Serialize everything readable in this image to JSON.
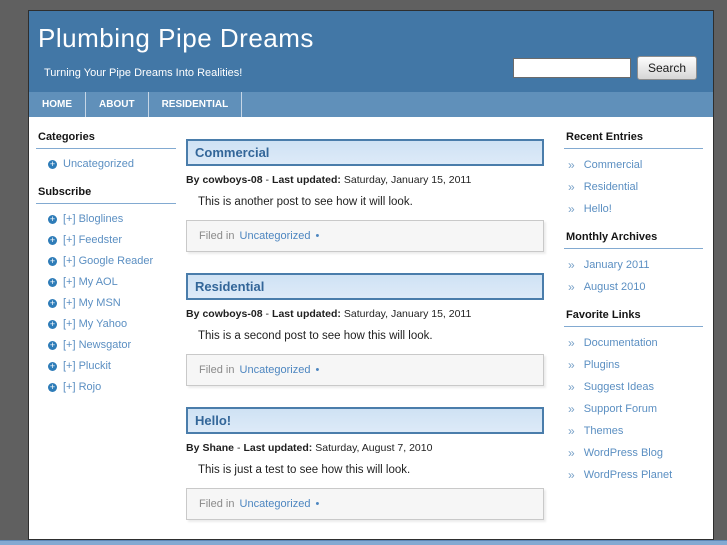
{
  "header": {
    "title": "Plumbing Pipe Dreams",
    "tagline": "Turning Your Pipe Dreams Into Realities!"
  },
  "search": {
    "button_label": "Search",
    "value": ""
  },
  "nav": {
    "items": [
      {
        "label": "HOME"
      },
      {
        "label": "ABOUT"
      },
      {
        "label": "RESIDENTIAL"
      }
    ]
  },
  "left_sidebar": {
    "sections": [
      {
        "title": "Categories",
        "items": [
          {
            "label": "Uncategorized"
          }
        ]
      },
      {
        "title": "Subscribe",
        "items": [
          {
            "label": "[+] Bloglines"
          },
          {
            "label": "[+] Feedster"
          },
          {
            "label": "[+] Google Reader"
          },
          {
            "label": "[+] My AOL"
          },
          {
            "label": "[+] My MSN"
          },
          {
            "label": "[+] My Yahoo"
          },
          {
            "label": "[+] Newsgator"
          },
          {
            "label": "[+] Pluckit"
          },
          {
            "label": "[+] Rojo"
          }
        ]
      }
    ]
  },
  "posts": [
    {
      "title": "Commercial",
      "by_label": "By",
      "author": "cowboys-08",
      "dash": "-",
      "updated_label": "Last updated:",
      "date": "Saturday, January 15, 2011",
      "body": "This is another post to see how it will look.",
      "filed_label": "Filed in",
      "category": "Uncategorized",
      "bullet": "•"
    },
    {
      "title": "Residential",
      "by_label": "By",
      "author": "cowboys-08",
      "dash": "-",
      "updated_label": "Last updated:",
      "date": "Saturday, January 15, 2011",
      "body": "This is a second post to see how this will look.",
      "filed_label": "Filed in",
      "category": "Uncategorized",
      "bullet": "•"
    },
    {
      "title": "Hello!",
      "by_label": "By",
      "author": "Shane",
      "dash": "-",
      "updated_label": "Last updated:",
      "date": "Saturday, August 7, 2010",
      "body": "This is just a test to see how this will look.",
      "filed_label": "Filed in",
      "category": "Uncategorized",
      "bullet": "•"
    }
  ],
  "right_sidebar": {
    "sections": [
      {
        "title": "Recent Entries",
        "items": [
          {
            "label": "Commercial"
          },
          {
            "label": "Residential"
          },
          {
            "label": "Hello!"
          }
        ]
      },
      {
        "title": "Monthly Archives",
        "items": [
          {
            "label": "January 2011"
          },
          {
            "label": "August 2010"
          }
        ]
      },
      {
        "title": "Favorite Links",
        "items": [
          {
            "label": "Documentation"
          },
          {
            "label": "Plugins"
          },
          {
            "label": "Suggest Ideas"
          },
          {
            "label": "Support Forum"
          },
          {
            "label": "Themes"
          },
          {
            "label": "WordPress Blog"
          },
          {
            "label": "WordPress Planet"
          }
        ]
      }
    ]
  },
  "colors": {
    "header_blue": "#4277a6",
    "nav_blue": "#6090ba",
    "link_blue": "#5b8fc2",
    "post_title_blue": "#336699",
    "title_box_bg": "#d6e6f7",
    "title_box_border": "#4a7dab",
    "bottom_bar_blue": "#83a9d2",
    "frame_gray": "#606060"
  }
}
